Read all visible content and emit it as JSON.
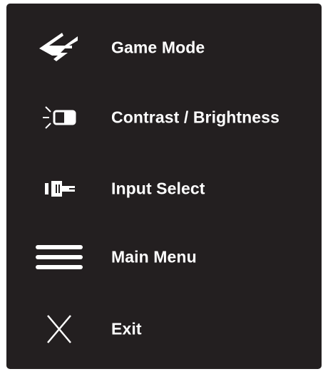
{
  "osd_menu": {
    "items": [
      {
        "label": "Game Mode",
        "icon": "game-mode-icon"
      },
      {
        "label": "Contrast / Brightness",
        "icon": "contrast-brightness-icon"
      },
      {
        "label": "Input Select",
        "icon": "input-select-icon"
      },
      {
        "label": "Main Menu",
        "icon": "main-menu-icon"
      },
      {
        "label": "Exit",
        "icon": "exit-icon"
      }
    ]
  },
  "colors": {
    "panel_background": "#231f20",
    "text": "#ffffff",
    "page_background": "#ffffff"
  }
}
